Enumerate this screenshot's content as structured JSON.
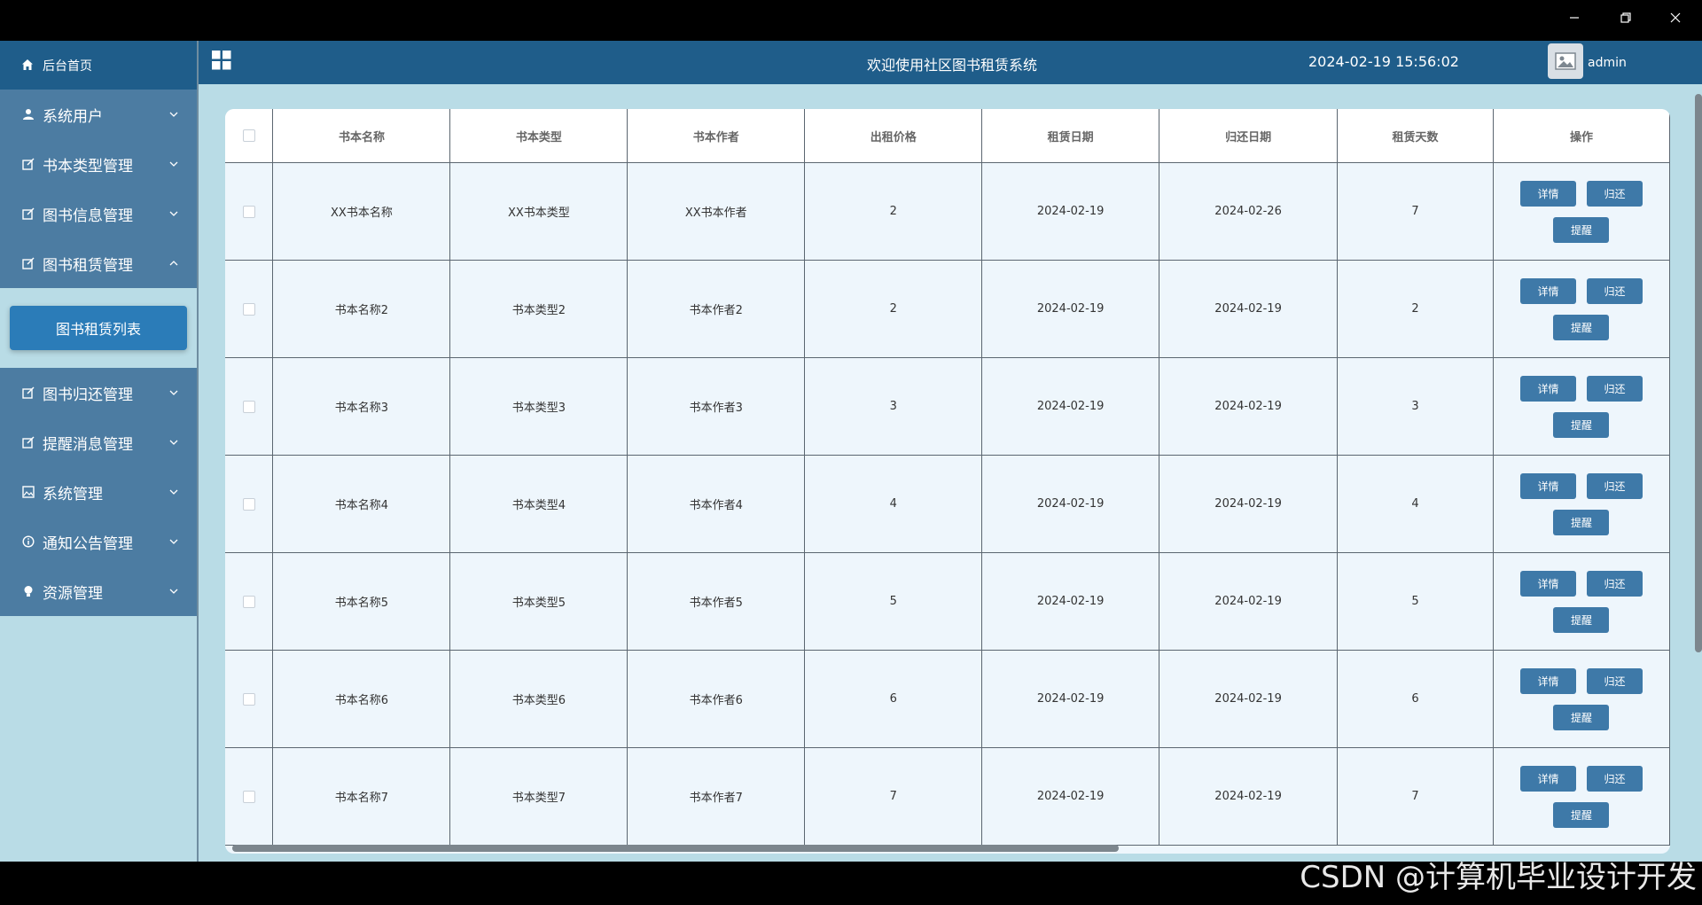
{
  "window": {
    "min_label": "minimize",
    "restore_label": "restore",
    "close_label": "close"
  },
  "sidebar": {
    "home": "后台首页",
    "items": [
      {
        "label": "系统用户",
        "icon": "user-icon",
        "expanded": false
      },
      {
        "label": "书本类型管理",
        "icon": "edit-icon",
        "expanded": false
      },
      {
        "label": "图书信息管理",
        "icon": "edit-icon",
        "expanded": false
      },
      {
        "label": "图书租赁管理",
        "icon": "edit-icon",
        "expanded": true
      },
      {
        "label": "图书归还管理",
        "icon": "edit-icon",
        "expanded": false
      },
      {
        "label": "提醒消息管理",
        "icon": "edit-icon",
        "expanded": false
      },
      {
        "label": "系统管理",
        "icon": "image-icon",
        "expanded": false
      },
      {
        "label": "通知公告管理",
        "icon": "info-icon",
        "expanded": false
      },
      {
        "label": "资源管理",
        "icon": "bulb-icon",
        "expanded": false
      }
    ],
    "sub_item": "图书租赁列表"
  },
  "header": {
    "title": "欢迎使用社区图书租赁系统",
    "datetime": "2024-02-19 15:56:02",
    "user": "admin"
  },
  "table": {
    "columns": [
      "书本名称",
      "书本类型",
      "书本作者",
      "出租价格",
      "租赁日期",
      "归还日期",
      "租赁天数",
      "操作"
    ],
    "rows": [
      [
        "XX书本名称",
        "XX书本类型",
        "XX书本作者",
        "2",
        "2024-02-19",
        "2024-02-26",
        "7"
      ],
      [
        "书本名称2",
        "书本类型2",
        "书本作者2",
        "2",
        "2024-02-19",
        "2024-02-19",
        "2"
      ],
      [
        "书本名称3",
        "书本类型3",
        "书本作者3",
        "3",
        "2024-02-19",
        "2024-02-19",
        "3"
      ],
      [
        "书本名称4",
        "书本类型4",
        "书本作者4",
        "4",
        "2024-02-19",
        "2024-02-19",
        "4"
      ],
      [
        "书本名称5",
        "书本类型5",
        "书本作者5",
        "5",
        "2024-02-19",
        "2024-02-19",
        "5"
      ],
      [
        "书本名称6",
        "书本类型6",
        "书本作者6",
        "6",
        "2024-02-19",
        "2024-02-19",
        "6"
      ],
      [
        "书本名称7",
        "书本类型7",
        "书本作者7",
        "7",
        "2024-02-19",
        "2024-02-19",
        "7"
      ]
    ],
    "actions": {
      "detail": "详情",
      "return": "归还",
      "remind": "提醒"
    }
  },
  "watermark": "CSDN @计算机毕业设计开发",
  "colors": {
    "accent": "#1f5d8a",
    "sidebar": "#4c7ca2",
    "background": "#b9dce6",
    "button": "#3e79a8"
  }
}
